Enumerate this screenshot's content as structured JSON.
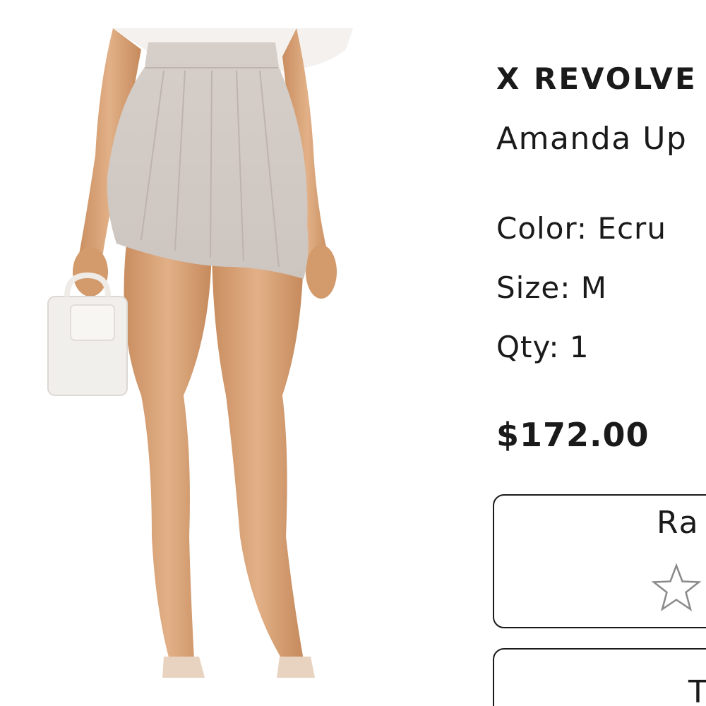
{
  "product": {
    "brand": "X REVOLVE",
    "name": "Amanda Up",
    "color_label": "Color: Ecru",
    "size_label": "Size: M",
    "qty_label": "Qty: 1",
    "price": "$172.00"
  },
  "rating": {
    "title": "Ra",
    "star_icon": "star-outline-icon",
    "value": 0
  },
  "second_panel": {
    "title": "T"
  },
  "colors": {
    "skirt": "#d9d2cc",
    "skin": "#d9a57a",
    "text": "#1a1a1a"
  }
}
